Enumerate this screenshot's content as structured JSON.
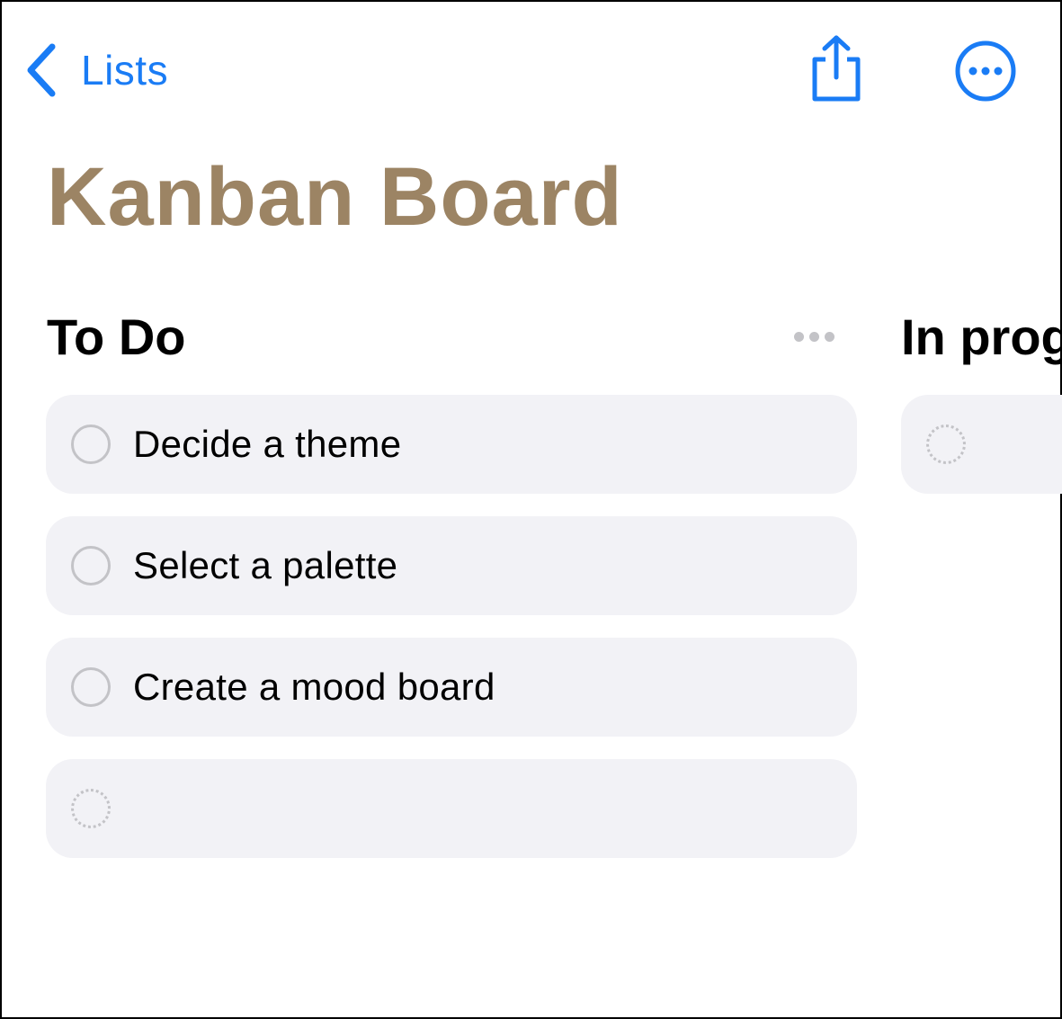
{
  "nav": {
    "back_label": "Lists",
    "accent_color": "#1a7cf5",
    "back_icon": "chevron-left-icon",
    "share_icon": "share-icon",
    "more_icon": "ellipsis-circle-icon"
  },
  "board": {
    "title": "Kanban Board",
    "title_color": "#9c8464"
  },
  "columns": [
    {
      "title": "To Do",
      "tasks": [
        "Decide a theme",
        "Select a palette",
        "Create a mood board"
      ],
      "new_item_placeholder": ""
    },
    {
      "title": "In prog",
      "tasks": [],
      "new_item_placeholder": ""
    }
  ]
}
